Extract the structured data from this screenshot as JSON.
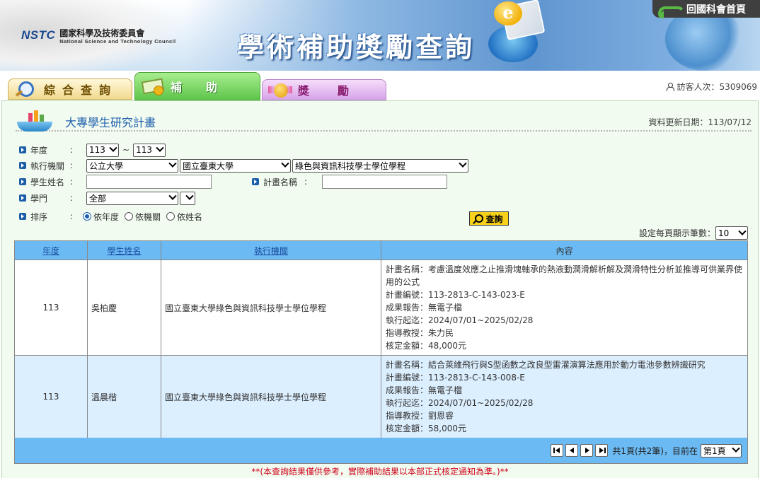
{
  "header": {
    "logo_text": "NSTC",
    "org_cn": "國家科學及技術委員會",
    "org_en": "National Science and Technology Council",
    "site_title": "學術補助獎勵查詢",
    "home_link": "回國科會首頁"
  },
  "tabs": [
    {
      "label": "綜合查詢",
      "icon": "magnifier-icon",
      "active": false
    },
    {
      "label": "補助",
      "icon": "money-icon",
      "active": true
    },
    {
      "label": "獎勵",
      "icon": "medal-icon",
      "active": false
    }
  ],
  "visitors": "訪客人次：5309069",
  "section": {
    "title": "大專學生研究計畫",
    "update_date": "資料更新日期：113/07/12"
  },
  "form": {
    "year_label": "年度",
    "year_from": "113",
    "year_sep": "~",
    "year_to": "113",
    "org_label": "執行機關",
    "org_type": "公立大學",
    "org_school": "國立臺東大學",
    "org_dept": "綠色與資訊科技學士學位學程",
    "student_label": "學生姓名",
    "student_value": "",
    "project_label": "計畫名稱",
    "project_value": "",
    "field_label": "學門",
    "field_value": "全部",
    "field_sub": "",
    "sort_label": "排序",
    "sort_options": [
      "依年度",
      "依機關",
      "依姓名"
    ],
    "sort_selected": "依年度",
    "query_button": "查詢",
    "per_page_label": "設定每頁顯示筆數：",
    "per_page_value": "10"
  },
  "table": {
    "headers": [
      "年度",
      "學生姓名",
      "執行機關",
      "內容"
    ],
    "rows": [
      {
        "year": "113",
        "name": "吳柏慶",
        "org": "國立臺東大學綠色與資訊科技學士學位學程",
        "content": {
          "title": "計畫名稱：考慮溫度效應之止推滑塊軸承的熱液動潤滑解析解及潤滑特性分析並推導可供業界使用的公式",
          "number": "計畫編號：113-2813-C-143-023-E",
          "report": "成果報告：無電子檔",
          "period": "執行起迄：2024/07/01~2025/02/28",
          "advisor": "指導教授：朱力民",
          "amount": "核定金額：48,000元"
        }
      },
      {
        "year": "113",
        "name": "溫晨楷",
        "org": "國立臺東大學綠色與資訊科技學士學位學程",
        "content": {
          "title": "計畫名稱：結合萊維飛行與S型函數之改良型雷灌演算法應用於動力電池參數辨識研究",
          "number": "計畫編號：113-2813-C-143-008-E",
          "report": "成果報告：無電子檔",
          "period": "執行起迄：2024/07/01~2025/02/28",
          "advisor": "指導教授：劉恩睿",
          "amount": "核定金額：58,000元"
        }
      }
    ]
  },
  "pager": {
    "summary": "共1頁(共2筆)，目前在",
    "current_page": "第1頁"
  },
  "disclaimer": "**(本查詢結果僅供參考，實際補助結果以本部正式核定通知為準。)**"
}
